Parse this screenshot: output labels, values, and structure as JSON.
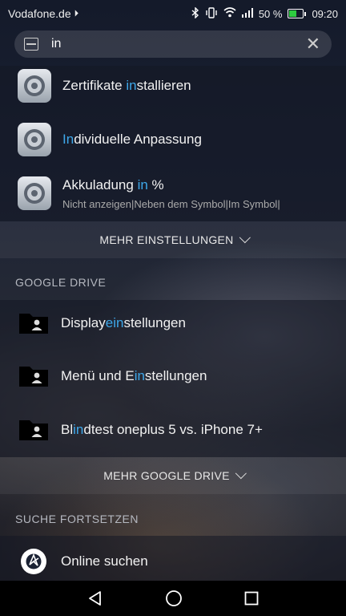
{
  "status_bar": {
    "carrier": "Vodafone.de",
    "battery_percent": "50 %",
    "time": "09:20"
  },
  "search": {
    "query": "in"
  },
  "settings_results": [
    {
      "before": "Zertifikate ",
      "match": "in",
      "after": "stallieren",
      "subtitle": ""
    },
    {
      "before": "",
      "match": "In",
      "after": "dividuelle Anpassung",
      "subtitle": ""
    },
    {
      "before": "Akkuladung ",
      "match": "in",
      "after": " %",
      "subtitle": "Nicht anzeigen|Neben dem Symbol|Im Symbol|"
    }
  ],
  "more_settings_label": "MEHR EINSTELLUNGEN",
  "google_drive": {
    "header": "GOOGLE DRIVE",
    "results": [
      {
        "before": "Display",
        "match": "ein",
        "after": "stellungen"
      },
      {
        "before": "Menü und E",
        "match": "in",
        "after": "stellungen"
      },
      {
        "before": "Bl",
        "match": "in",
        "after": "dtest oneplus 5 vs. iPhone 7+"
      }
    ],
    "more_label": "MEHR GOOGLE DRIVE"
  },
  "continue_search": {
    "header": "SUCHE FORTSETZEN",
    "online_label": "Online suchen"
  },
  "colors": {
    "highlight": "#3ea8ea",
    "battery_fill": "#2ecc40"
  }
}
